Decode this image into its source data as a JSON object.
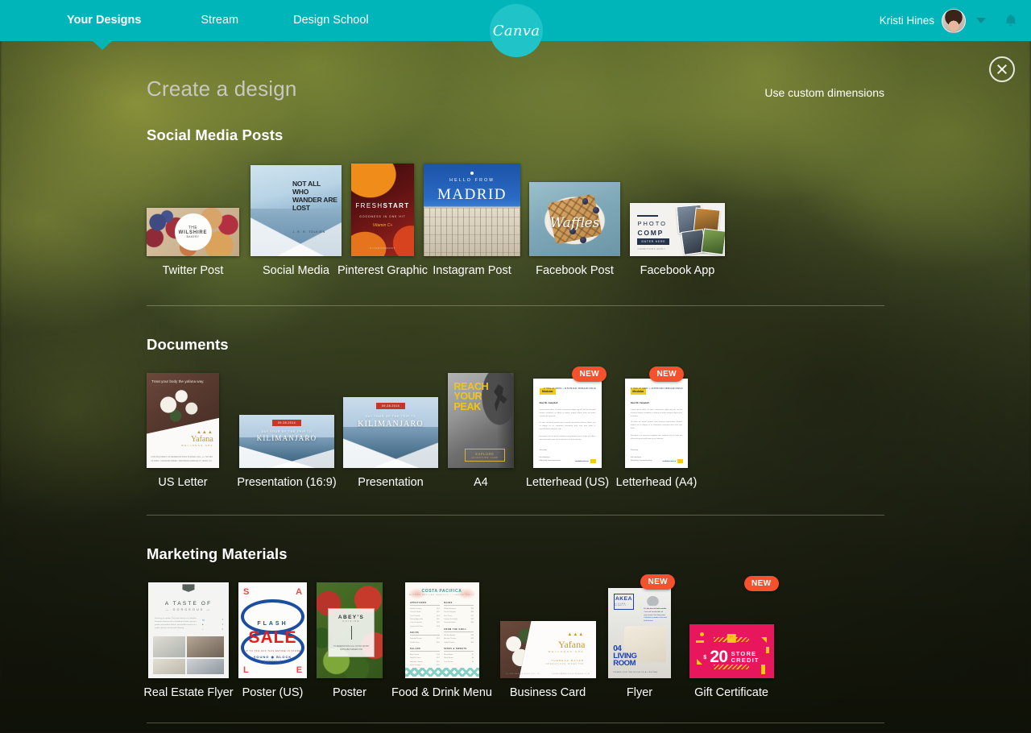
{
  "header": {
    "nav": [
      {
        "label": "Your Designs",
        "active": true
      },
      {
        "label": "Stream",
        "active": false
      },
      {
        "label": "Design School",
        "active": false
      }
    ],
    "logo_text": "Canva",
    "user_name": "Kristi Hines",
    "avatar_name": "user-avatar",
    "bell_name": "notifications-bell-icon",
    "accent_color": "#00b5ba"
  },
  "overlay": {
    "close_label": "close",
    "title": "Create a design",
    "custom_dimensions": "Use custom dimensions"
  },
  "sections": [
    {
      "title": "Social Media Posts",
      "items": [
        {
          "label": "Twitter Post",
          "new": false
        },
        {
          "label": "Social Media",
          "new": false
        },
        {
          "label": "Pinterest Graphic",
          "new": false
        },
        {
          "label": "Instagram Post",
          "new": false
        },
        {
          "label": "Facebook Post",
          "new": false
        },
        {
          "label": "Facebook App",
          "new": false
        }
      ]
    },
    {
      "title": "Documents",
      "items": [
        {
          "label": "US Letter",
          "new": false
        },
        {
          "label": "Presentation (16:9)",
          "new": false
        },
        {
          "label": "Presentation",
          "new": false
        },
        {
          "label": "A4",
          "new": false
        },
        {
          "label": "Letterhead (US)",
          "new": true
        },
        {
          "label": "Letterhead (A4)",
          "new": true
        }
      ]
    },
    {
      "title": "Marketing Materials",
      "items": [
        {
          "label": "Real Estate Flyer",
          "new": false
        },
        {
          "label": "Poster (US)",
          "new": false
        },
        {
          "label": "Poster",
          "new": false
        },
        {
          "label": "Food & Drink Menu",
          "new": false
        },
        {
          "label": "Business Card",
          "new": false
        },
        {
          "label": "Flyer",
          "new": true
        },
        {
          "label": "Gift Certificate",
          "new": true
        }
      ]
    }
  ],
  "badge_new_label": "NEW",
  "badge_new_color": "#f4512c",
  "thumbs": {
    "twitter": {
      "brand_top": "THE",
      "brand": "WILSHIRE",
      "brand_sub": "BAKERY"
    },
    "social_media": {
      "quote": "NOT ALL WHO WANDER ARE LOST",
      "cite": "J. R. R. TOLKIEN"
    },
    "pinterest": {
      "word1": "FRESH",
      "word2": "START",
      "sub": "GOODNESS IN ONE HIT",
      "vitamin": "Vitamin C+",
      "foot": "VITAMINBOOST"
    },
    "instagram": {
      "kicker": "HELLO FROM",
      "city": "MADRID"
    },
    "facebook": {
      "script": "Waffles"
    },
    "facebook_app": {
      "line1": "PHOTO",
      "line2": "COMP",
      "cta": "ENTER HERE",
      "terms": "CONDITIONS APPLY"
    },
    "us_letter": {
      "headline": "Treat your body the yafana way.",
      "brand": "Yafana",
      "brand_sub": "WELLNESS SPA",
      "foot": "FOR INQUIRIES OR RESERVATIONS PLEASE CALL +1 718 384 33 6689 / YAFANAB CREEK, WESTERN AVENUE NY, 90201 US"
    },
    "presentation_169": {
      "date": "09.28.2014",
      "kicker": "DAY TOUR OF THE TRIP TO",
      "title": "KILIMANJARO"
    },
    "presentation": {
      "date": "09.28.2014",
      "kicker": "DAY TOUR OF THE TRIP TO",
      "title": "KILIMANJARO"
    },
    "a4": {
      "l1": "REACH",
      "l2": "YOUR",
      "l3": "PEAK",
      "frame1": "EXPLORE",
      "frame2": "ADVENTURE CAMP"
    },
    "letterhead": {
      "logo": "Modular",
      "addr": "17 TRIAL ST, SWAN / + 44 56 89 0120 / MODULAR.COM.AU",
      "dear": "Dear Mr. Campbell",
      "sig1": "Sincerely,",
      "sig2": "Ian Glasheen",
      "sig3": "Marketing Communications",
      "url": "modular.com.au"
    },
    "real_estate": {
      "h1": "A TASTE OF",
      "h2": "— GORGEOUS —",
      "spec1": "4",
      "spec2": "3",
      "spec3": "2"
    },
    "poster_us": {
      "flash": "FLASH",
      "sale": "SALE",
      "upto": "UP TO 70% OFF THIS ENTIRE IN STORE",
      "brand": "YOUNG ◉ BLOCK",
      "site": "youngandblock.com",
      "corner1": "S",
      "corner2": "A",
      "corner3": "L",
      "corner4": "E"
    },
    "poster": {
      "name": "ABEY'S",
      "sub": "CUISINE",
      "info": "TO RESERVATION CALL 718 507 448 997 WWW.ABEYSDINER.COM"
    },
    "menu": {
      "title": "COSTA PACIFICA",
      "sub": "MODERN MEXICAN SEAFOOD / COASTAL GRILL",
      "col1_h1": "APPETIZERS",
      "col1_h2": "SOUPS",
      "col1_h3": "SALADS",
      "col2_h1": "MAINS",
      "col2_h2": "FROM THE GRILL",
      "col2_h3": "SIDES & SWEETS"
    },
    "business_card": {
      "brand": "Yafana",
      "brand_sub": "WELLNESS SPA",
      "person": "THERESA MAYER",
      "role": "OPERATIONS DIRECTOR",
      "phone": "+1 718 334 33 6689 LOC 19",
      "email": "THERESAMAYER@YAFANA.COM"
    },
    "flyer": {
      "brand": "AKEA",
      "brand_sub": "LIVING SIMPLY",
      "copy_head": "It's the best of both worlds",
      "copy": "Cool and comfortable all year round. Our living room collection is made to last and built to love.",
      "num": "04",
      "rm1": "LIVING",
      "rm2": "ROOM",
      "tag": "PRIMED FOR THE ROOM OF A LIFETIME"
    },
    "gift": {
      "dollar": "$",
      "amount": "20",
      "w1": "STORE",
      "w2": "CREDIT"
    }
  }
}
